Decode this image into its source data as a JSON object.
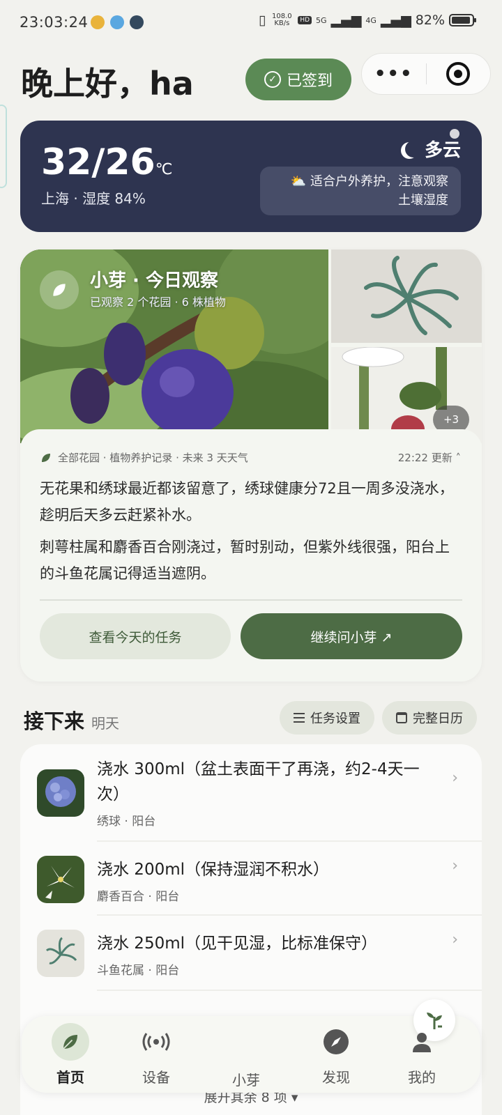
{
  "status_bar": {
    "time": "23:03:24",
    "net_speed_value": "108.0",
    "net_speed_unit": "KB/s",
    "hd_tag": "HD1\nHD2",
    "signal1": "5G",
    "signal2": "4G",
    "battery": "82%"
  },
  "header": {
    "greeting": "晚上好，ha",
    "checkin_label": "已签到",
    "more_label": "•••"
  },
  "weather": {
    "temp": "32/26",
    "unit": "℃",
    "location": "上海 · 湿度 84%",
    "condition": "多云",
    "tip_line1": "⛅ 适合户外养护，注意观察",
    "tip_line2": "土壤湿度"
  },
  "observation": {
    "title": "小芽 · 今日观察",
    "subtitle": "已观察 2 个花园 · 6 株植物",
    "more_photos": "+3",
    "meta": "全部花园 · 植物养护记录 · 未来 3 天天气",
    "updated": "22:22 更新 ˄",
    "paragraph1": "无花果和绣球最近都该留意了，绣球健康分72且一周多没浇水，趁明后天多云赶紧补水。",
    "paragraph2": "刺萼柱属和麝香百合刚浇过，暂时别动，但紫外线很强，阳台上的斗鱼花属记得适当遮阴。",
    "btn_tasks": "查看今天的任务",
    "btn_ask": "继续问小芽 ↗"
  },
  "next": {
    "title": "接下来",
    "when": "明天",
    "settings_label": "任务设置",
    "calendar_label": "完整日历"
  },
  "tasks": [
    {
      "title": "浇水 300ml（盆土表面干了再浇，约2-4天一次）",
      "sub": "绣球 · 阳台"
    },
    {
      "title": "浇水 200ml（保持湿润不积水）",
      "sub": "麝香百合 · 阳台"
    },
    {
      "title": "浇水 250ml（见干见湿，比标准保守）",
      "sub": "斗鱼花属 · 阳台"
    }
  ],
  "expand_label": "展开其余 8 项 ▾",
  "nav": {
    "home": "首页",
    "devices": "设备",
    "sprout": "小芽",
    "discover": "发现",
    "mine": "我的"
  },
  "colors": {
    "accent_green": "#5b8a55",
    "dark_green": "#4d6c45",
    "weather_bg": "#2e3450",
    "page_bg": "#f2f2ee"
  }
}
